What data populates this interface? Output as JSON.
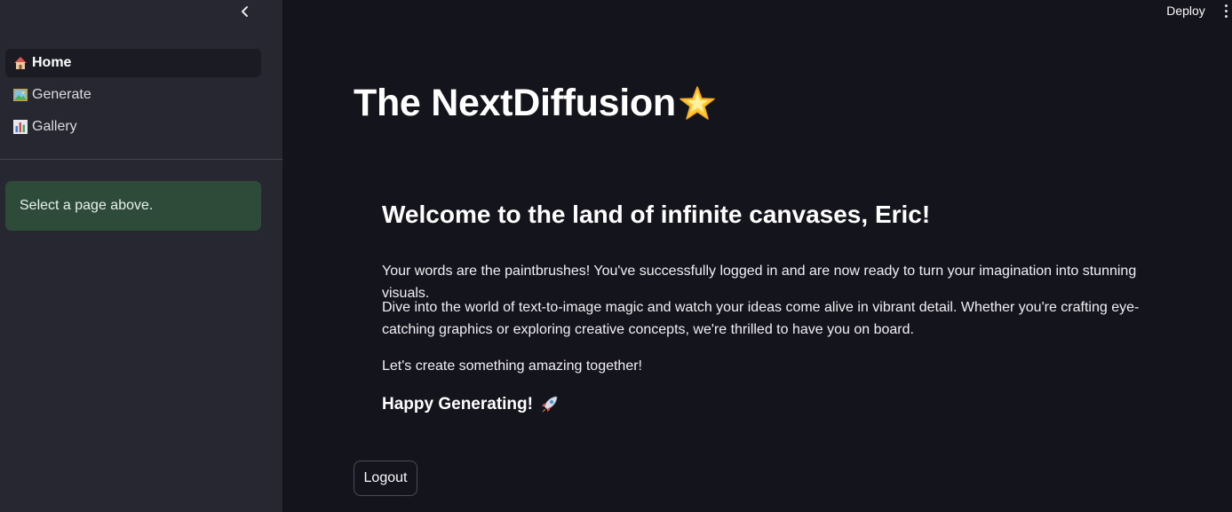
{
  "header": {
    "deploy_label": "Deploy"
  },
  "sidebar": {
    "items": [
      {
        "label": "Home",
        "icon": "house-icon",
        "active": true
      },
      {
        "label": "Generate",
        "icon": "picture-icon",
        "active": false
      },
      {
        "label": "Gallery",
        "icon": "bar-chart-icon",
        "active": false
      }
    ],
    "info": "Select a page above."
  },
  "main": {
    "title": "The NextDiffusion",
    "welcome": "Welcome to the land of infinite canvases, Eric!",
    "paragraphs": [
      "Your words are the paintbrushes! You've successfully logged in and are now ready to turn your imagination into stunning visuals.",
      "Dive into the world of text-to-image magic and watch your ideas come alive in vibrant detail. Whether you're crafting eye-catching graphics or exploring creative concepts, we're thrilled to have you on board.",
      "Let's create something amazing together!"
    ],
    "closing": "Happy Generating!",
    "logout_label": "Logout"
  },
  "colors": {
    "sidebar_bg": "#262730",
    "main_bg": "#14141c",
    "info_bg": "#2e4b3a"
  }
}
